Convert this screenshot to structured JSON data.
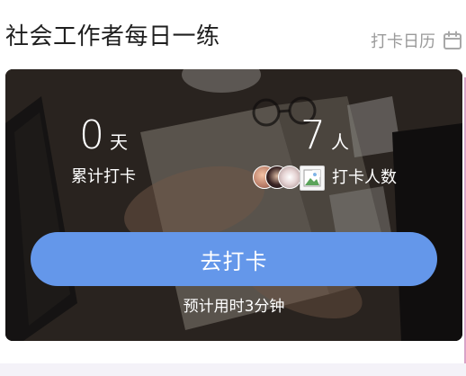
{
  "header": {
    "title": "社会工作者每日一练",
    "calendar_link_label": "打卡日历",
    "calendar_icon": "calendar-icon"
  },
  "card": {
    "background": "desk-photo-background",
    "days": {
      "value": "0",
      "unit": "天",
      "label": "累计打卡"
    },
    "people": {
      "value": "7",
      "unit": "人",
      "label": "打卡人数",
      "avatar_count_shown": 4
    },
    "checkin_button_label": "去打卡",
    "estimate_text": "预计用时3分钟"
  },
  "colors": {
    "button": "#6497ea",
    "title": "#1f1f1f",
    "muted": "#9a9a9a",
    "overlay_text": "#ffffff"
  }
}
